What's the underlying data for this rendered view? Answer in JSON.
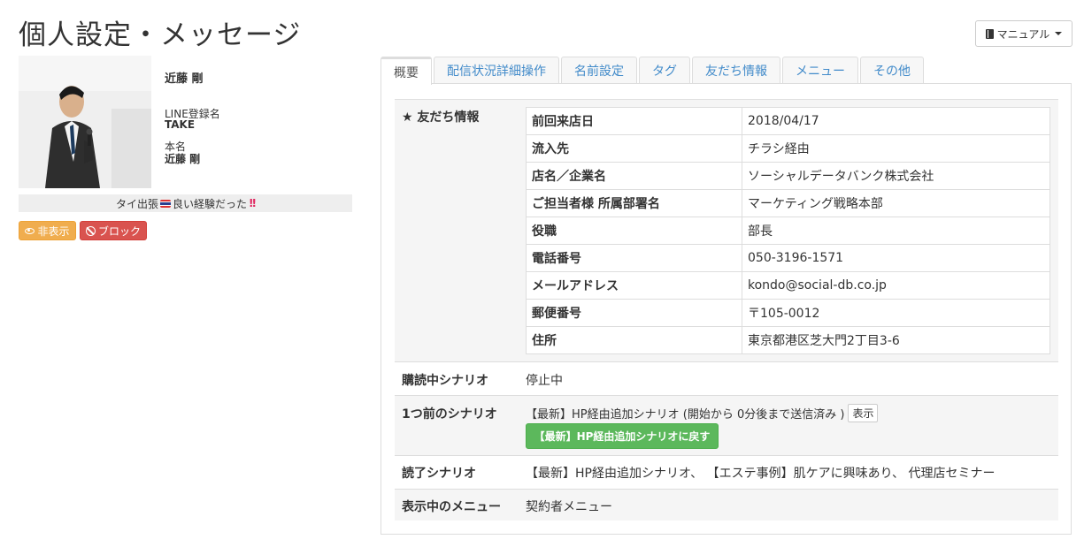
{
  "page": {
    "title": "個人設定・メッセージ",
    "manual_button": "マニュアル"
  },
  "profile": {
    "display_name": "近藤 剛",
    "line_name_label": "LINE登録名",
    "line_name": "TAKE",
    "real_name_label": "本名",
    "real_name": "近藤 剛",
    "status_message_pre": "タイ出張",
    "status_message_post": "良い経験だった",
    "hide_button": "非表示",
    "block_button": "ブロック"
  },
  "tabs": [
    {
      "label": "概要",
      "active": true
    },
    {
      "label": "配信状況詳細操作",
      "active": false
    },
    {
      "label": "名前設定",
      "active": false
    },
    {
      "label": "タグ",
      "active": false
    },
    {
      "label": "友だち情報",
      "active": false
    },
    {
      "label": "メニュー",
      "active": false
    },
    {
      "label": "その他",
      "active": false
    }
  ],
  "overview": {
    "friend_info": {
      "label": "★ 友だち情報",
      "rows": [
        {
          "key": "前回来店日",
          "value": "2018/04/17"
        },
        {
          "key": "流入先",
          "value": "チラシ経由"
        },
        {
          "key": "店名／企業名",
          "value": "ソーシャルデータバンク株式会社"
        },
        {
          "key": "ご担当者様 所属部署名",
          "value": "マーケティング戦略本部"
        },
        {
          "key": "役職",
          "value": "部長"
        },
        {
          "key": "電話番号",
          "value": "050-3196-1571"
        },
        {
          "key": "メールアドレス",
          "value": "kondo@social-db.co.jp"
        },
        {
          "key": "郵便番号",
          "value": "〒105-0012"
        },
        {
          "key": "住所",
          "value": "東京都港区芝大門2丁目3-6"
        }
      ]
    },
    "subscribed_scenario": {
      "label": "購読中シナリオ",
      "value": "停止中"
    },
    "previous_scenario": {
      "label": "1つ前のシナリオ",
      "value": "【最新】HP経由追加シナリオ (開始から 0分後まで送信済み )",
      "show_button": "表示",
      "back_button": "【最新】HP経由追加シナリオに戻す"
    },
    "read_scenario": {
      "label": "読了シナリオ",
      "value": "【最新】HP経由追加シナリオ、 【エステ事例】肌ケアに興味あり、 代理店セミナー"
    },
    "current_menu": {
      "label": "表示中のメニュー",
      "value": "契約者メニュー"
    }
  },
  "colors": {
    "tab_active_accent": "#5cb85c",
    "tab_link": "#428bca",
    "hide_button": "#f0ad4e",
    "block_button": "#d9534f",
    "back_button": "#5cb85c"
  }
}
